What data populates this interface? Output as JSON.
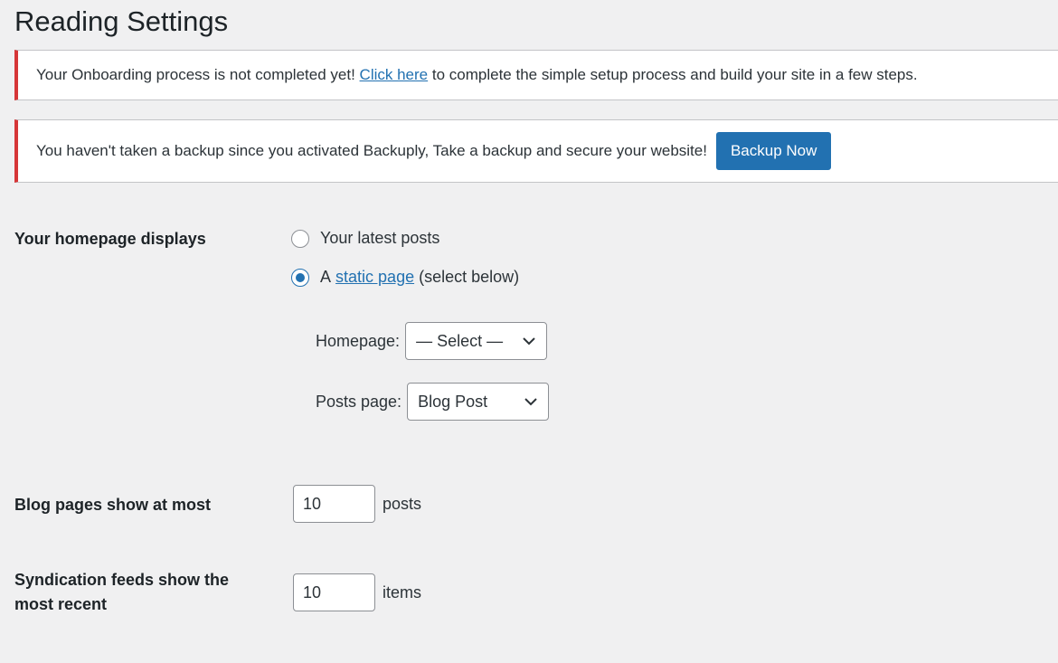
{
  "page": {
    "title": "Reading Settings"
  },
  "notices": {
    "onboarding": {
      "text_before": "Your Onboarding process is not completed yet!",
      "link": "Click here",
      "text_after": "to complete the simple setup process and build your site in a few steps."
    },
    "backup": {
      "text": "You haven't taken a backup since you activated Backuply, Take a backup and secure your website!",
      "button": "Backup Now"
    }
  },
  "homepage_displays": {
    "label": "Your homepage displays",
    "option_latest": "Your latest posts",
    "option_static_prefix": "A",
    "option_static_link": "static page",
    "option_static_suffix": "(select below)",
    "selected": "static page",
    "homepage_label": "Homepage:",
    "homepage_value": "— Select —",
    "posts_page_label": "Posts page:",
    "posts_page_value": "Blog Post"
  },
  "blog_pages": {
    "label": "Blog pages show at most",
    "value": "10",
    "unit": "posts"
  },
  "syndication": {
    "label_line1": "Syndication feeds show the",
    "label_line2": "most recent",
    "value": "10",
    "unit": "items"
  },
  "colors": {
    "accent": "#2271b1",
    "error_border": "#d63638",
    "background": "#f0f0f1"
  },
  "icons": {
    "select_arrow": "chevron-down-icon"
  }
}
